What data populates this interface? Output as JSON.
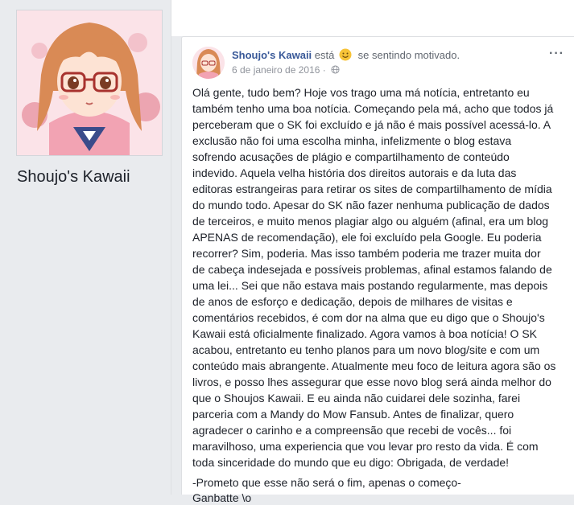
{
  "page": {
    "name": "Shoujo's Kawaii"
  },
  "post": {
    "author": "Shoujo's Kawaii",
    "feeling_prefix": "está",
    "feeling_text": "se sentindo motivado.",
    "date": "6 de janeiro de 2016",
    "separator": "·",
    "more_label": "···",
    "body": "Olá gente, tudo bem? Hoje vos trago uma má notícia, entretanto eu também tenho uma boa notícia. Começando pela má, acho que todos já perceberam que o SK foi excluído e já não é mais possível acessá-lo. A exclusão não foi uma escolha minha, infelizmente o blog estava sofrendo acusações de plágio e compartilhamento de conteúdo indevido. Aquela velha história dos direitos autorais e da luta das editoras estrangeiras para retirar os sites de compartilhamento de mídia do mundo todo. Apesar do SK não fazer nenhuma publicação de dados de terceiros, e muito menos plagiar algo ou alguém (afinal, era um blog APENAS de recomendação), ele foi excluído pela Google. Eu poderia recorrer? Sim, poderia. Mas isso também poderia me trazer muita dor de cabeça indesejada e possíveis problemas, afinal estamos falando de uma lei... Sei que não estava mais postando regularmente, mas depois de anos de esforço e dedicação, depois de milhares de visitas e comentários recebidos, é com dor na alma que eu digo que o Shoujo's Kawaii está oficialmente finalizado. Agora vamos à boa notícia! O SK acabou, entretanto eu tenho planos para um novo blog/site e com um conteúdo mais abrangente. Atualmente meu foco de leitura agora são os livros, e posso lhes assegurar que esse novo blog será ainda melhor do que o Shoujos Kawaii. E eu ainda não cuidarei dele sozinha, farei parceria com a Mandy do Mow Fansub. Antes de finalizar, quero agradecer o carinho e a compreensão que recebi de vocês... foi maravilhoso, uma experiencia que vou levar pro resto da vida. É com toda sinceridade do mundo que eu digo: Obrigada, de verdade!",
    "closing_line_1": "-Prometo que esse não será o fim, apenas o começo-",
    "closing_line_2": "Ganbatte \\o"
  },
  "icons": {
    "feeling": "smiling-face-emoji",
    "privacy": "globe-icon",
    "menu": "more-options-icon"
  },
  "colors": {
    "author_link": "#385898",
    "background": "#e9ebee",
    "card": "#ffffff",
    "meta": "#90949c"
  }
}
